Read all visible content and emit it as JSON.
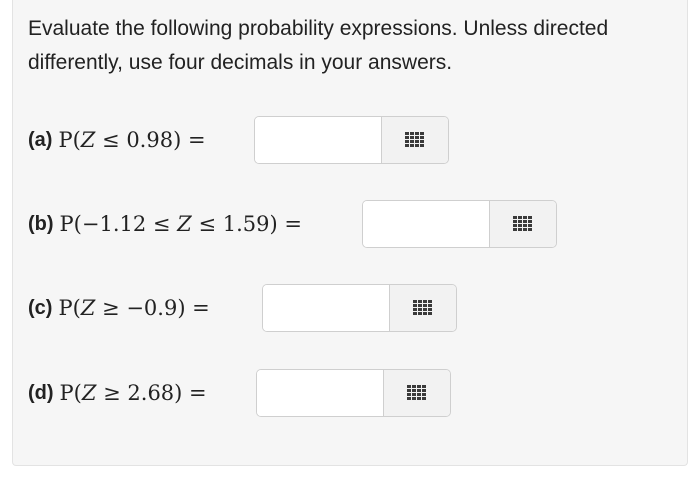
{
  "instructions": "Evaluate the following probability expressions. Unless directed differently, use four decimals in your answers.",
  "questions": [
    {
      "label": "(a)",
      "expr_prefix": "P(",
      "expr_var1": "Z",
      "expr_rest": " ≤ 0.98) =",
      "answer_value": "",
      "answer_placeholder": ""
    },
    {
      "label": "(b)",
      "expr_prefix": "P(−1.12 ≤ ",
      "expr_var1": "Z",
      "expr_rest": " ≤ 1.59) =",
      "answer_value": "",
      "answer_placeholder": ""
    },
    {
      "label": "(c)",
      "expr_prefix": "P(",
      "expr_var1": "Z",
      "expr_rest": " ≥ −0.9) =",
      "answer_value": "",
      "answer_placeholder": ""
    },
    {
      "label": "(d)",
      "expr_prefix": "P(",
      "expr_var1": "Z",
      "expr_rest": " ≥ 2.68) =",
      "answer_value": "",
      "answer_placeholder": ""
    }
  ],
  "icons": {
    "keypad": "keypad-grid-icon"
  },
  "colors": {
    "panel_background": "#f6f6f6",
    "text": "#222222",
    "icon": "#3a3a3a"
  }
}
